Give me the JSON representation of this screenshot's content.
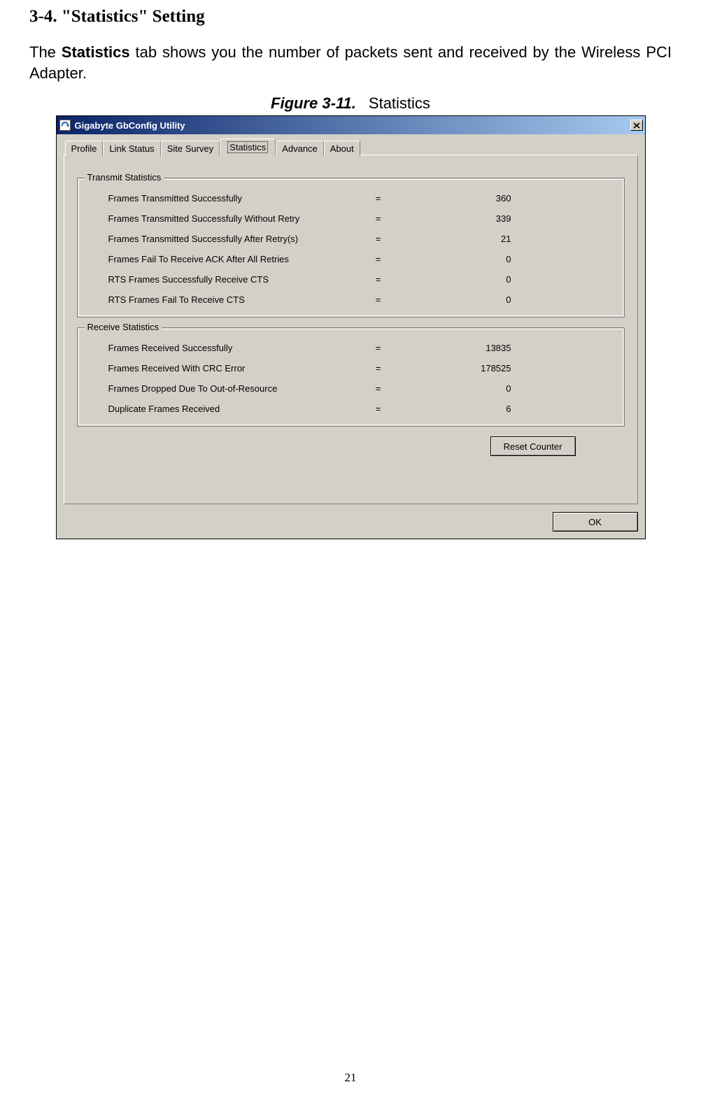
{
  "doc": {
    "heading": "3-4.    \"Statistics\" Setting",
    "body_pre": "The ",
    "body_bold": "Statistics",
    "body_post": " tab shows you the number of packets sent and received by the Wireless PCI Adapter.",
    "fig_label": "Figure 3-11.",
    "fig_title": "Statistics",
    "page_number": "21"
  },
  "dialog": {
    "title": "Gigabyte GbConfig Utility",
    "close": "X",
    "tabs": {
      "profile": "Profile",
      "link_status": "Link Status",
      "site_survey": "Site Survey",
      "statistics": "Statistics",
      "advance": "Advance",
      "about": "About"
    },
    "groups": {
      "transmit_legend": "Transmit Statistics",
      "receive_legend": "Receive Statistics"
    },
    "transmit": {
      "r0": {
        "label": "Frames Transmitted Successfully",
        "eq": "=",
        "val": "360"
      },
      "r1": {
        "label": "Frames Transmitted Successfully  Without Retry",
        "eq": "=",
        "val": "339"
      },
      "r2": {
        "label": "Frames Transmitted Successfully After Retry(s)",
        "eq": "=",
        "val": "21"
      },
      "r3": {
        "label": "Frames Fail To Receive ACK After All Retries",
        "eq": "=",
        "val": "0"
      },
      "r4": {
        "label": "RTS Frames Successfully Receive CTS",
        "eq": "=",
        "val": "0"
      },
      "r5": {
        "label": "RTS Frames Fail To Receive CTS",
        "eq": "=",
        "val": "0"
      }
    },
    "receive": {
      "r0": {
        "label": "Frames Received Successfully",
        "eq": "=",
        "val": "13835"
      },
      "r1": {
        "label": "Frames Received With CRC Error",
        "eq": "=",
        "val": "178525"
      },
      "r2": {
        "label": "Frames Dropped Due To Out-of-Resource",
        "eq": "=",
        "val": "0"
      },
      "r3": {
        "label": "Duplicate Frames Received",
        "eq": "=",
        "val": "6"
      }
    },
    "buttons": {
      "reset": "Reset Counter",
      "ok": "OK"
    }
  }
}
